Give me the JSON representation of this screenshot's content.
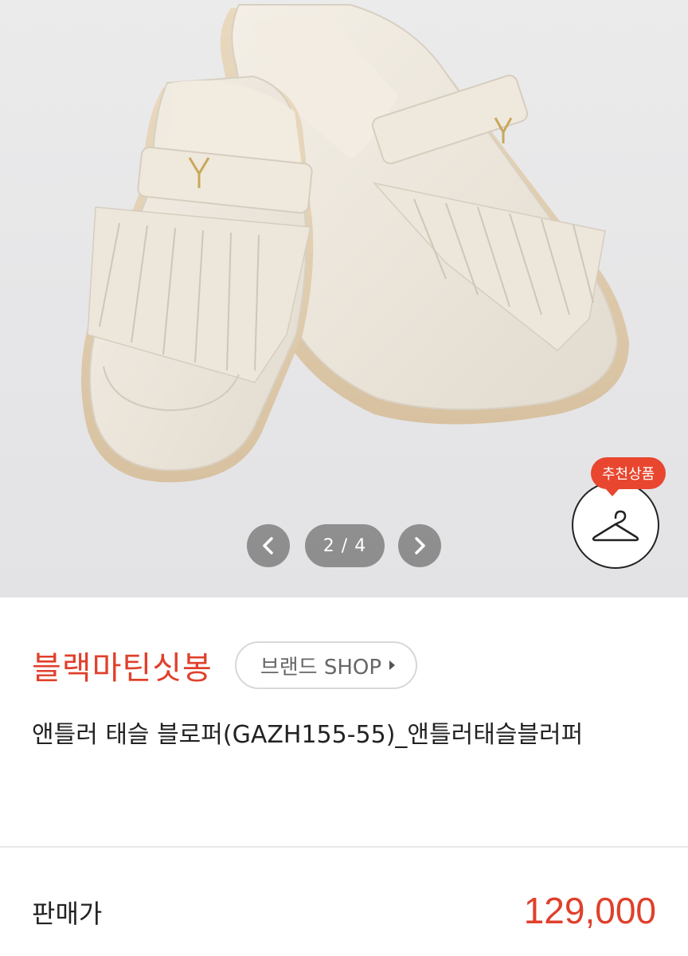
{
  "gallery": {
    "image_alt": "product-photo",
    "counter": "2 / 4",
    "recommend_tag": "추천상품"
  },
  "brand": {
    "name": "블랙마틴싯봉",
    "shop_button": "브랜드 SHOP"
  },
  "product": {
    "title": "앤틀러 태슬 블로퍼(GAZH155-55)_앤틀러태슬블러퍼"
  },
  "price": {
    "label": "판매가",
    "value": "129,000"
  },
  "colors": {
    "accent": "#e0402c",
    "tag": "#e8462f"
  }
}
